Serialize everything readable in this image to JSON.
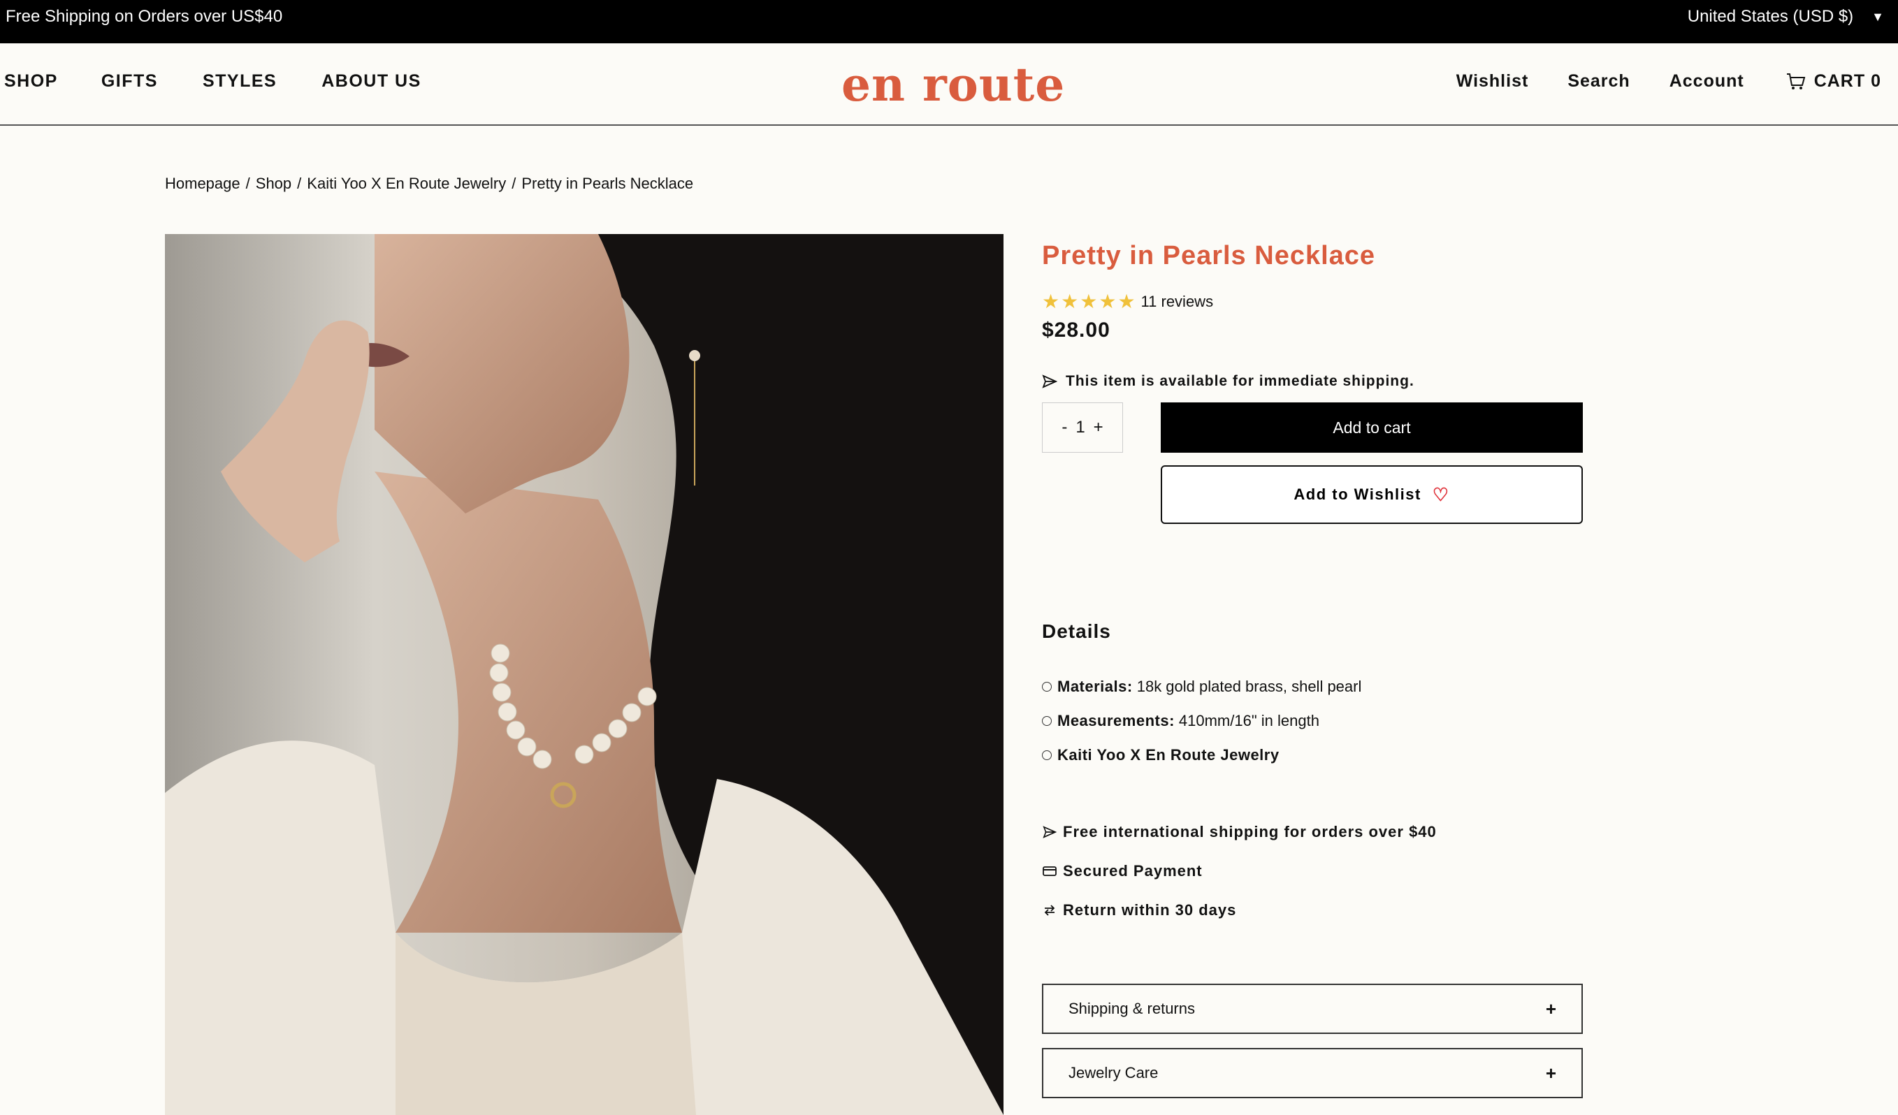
{
  "topbar": {
    "promo": "Free Shipping on Orders over US$40",
    "region": "United States (USD $)",
    "region_caret": "▼"
  },
  "nav": {
    "left_links": [
      "SHOP",
      "GIFTS",
      "STYLES",
      "ABOUT US"
    ],
    "logo": "en route",
    "wishlist": "Wishlist",
    "search": "Search",
    "account": "Account",
    "cart": "CART 0"
  },
  "breadcrumb": {
    "items": [
      "Homepage",
      "Shop",
      "Kaiti Yoo X En Route Jewelry",
      "Pretty in Pearls Necklace"
    ],
    "separator": "/"
  },
  "product": {
    "title": "Pretty in Pearls Necklace",
    "rating_stars": 5,
    "reviews": "11 reviews",
    "price": "$28.00",
    "availability": "This item is available for immediate shipping.",
    "qty_minus": "-",
    "qty_value": "1",
    "qty_plus": "+",
    "add_to_cart": "Add to cart",
    "add_to_wishlist": "Add to Wishlist",
    "colors": {
      "accent": "#d95c3e",
      "star": "#f0c13b",
      "heart": "#e0323a"
    }
  },
  "details": {
    "heading": "Details",
    "materials_label": "Materials:",
    "materials_value": "18k gold plated brass, shell pearl",
    "measurements_label": "Measurements:",
    "measurements_value": "410mm/16\" in length",
    "collection": "Kaiti Yoo X En Route Jewelry"
  },
  "perks": {
    "shipping": "Free international shipping for orders over $40",
    "payment": "Secured Payment",
    "returns": "Return within 30 days"
  },
  "accordions": {
    "shipping_returns": "Shipping & returns",
    "jewelry_care": "Jewelry Care",
    "toggle": "+"
  }
}
